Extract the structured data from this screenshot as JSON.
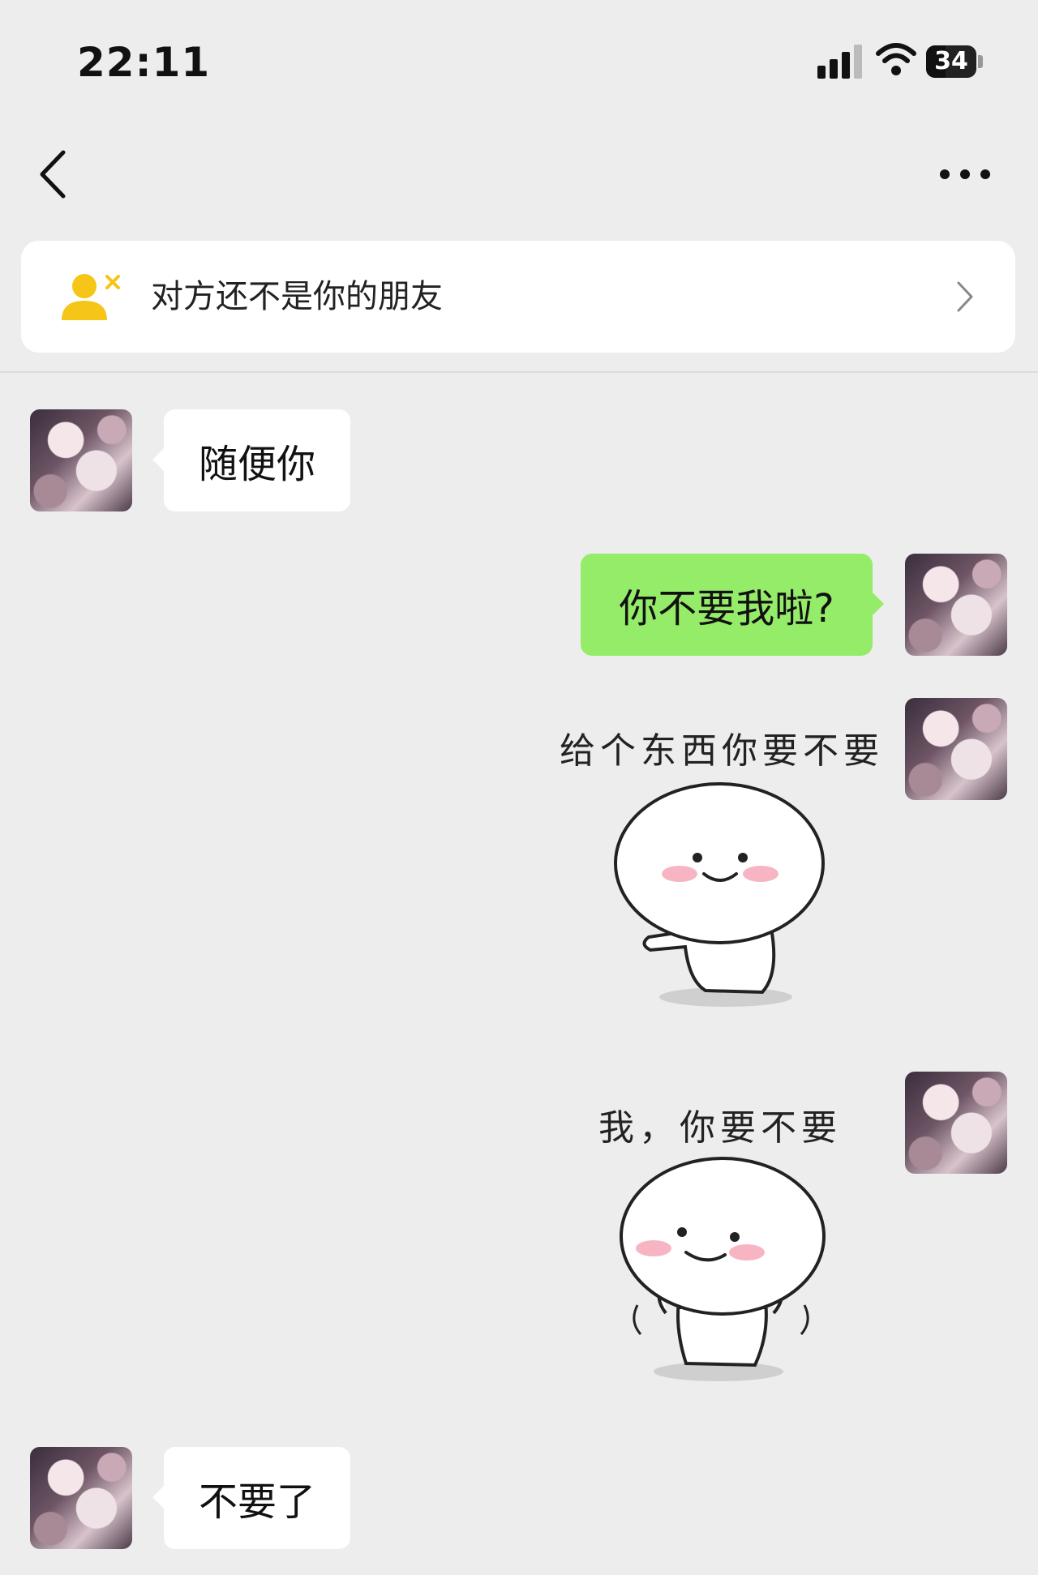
{
  "status_bar": {
    "time": "22:11",
    "battery": "34",
    "icons": [
      "signal-icon",
      "wifi-icon",
      "battery-icon"
    ]
  },
  "nav": {
    "back_icon": "chevron-left-icon",
    "more_icon": "more-dots-icon"
  },
  "banner": {
    "icon": "add-friend-icon",
    "text": "对方还不是你的朋友",
    "arrow_icon": "chevron-right-icon",
    "icon_color": "#f5c518"
  },
  "messages": [
    {
      "side": "in",
      "type": "text",
      "text": "随便你"
    },
    {
      "side": "out",
      "type": "text",
      "text": "你不要我啦?"
    },
    {
      "side": "out",
      "type": "sticker",
      "caption": "给个东西你要不要"
    },
    {
      "side": "out",
      "type": "sticker",
      "caption": "我，你要不要"
    },
    {
      "side": "in",
      "type": "text",
      "text": "不要了"
    }
  ],
  "colors": {
    "background": "#ededed",
    "incoming_bubble": "#ffffff",
    "outgoing_bubble": "#95ec69"
  }
}
